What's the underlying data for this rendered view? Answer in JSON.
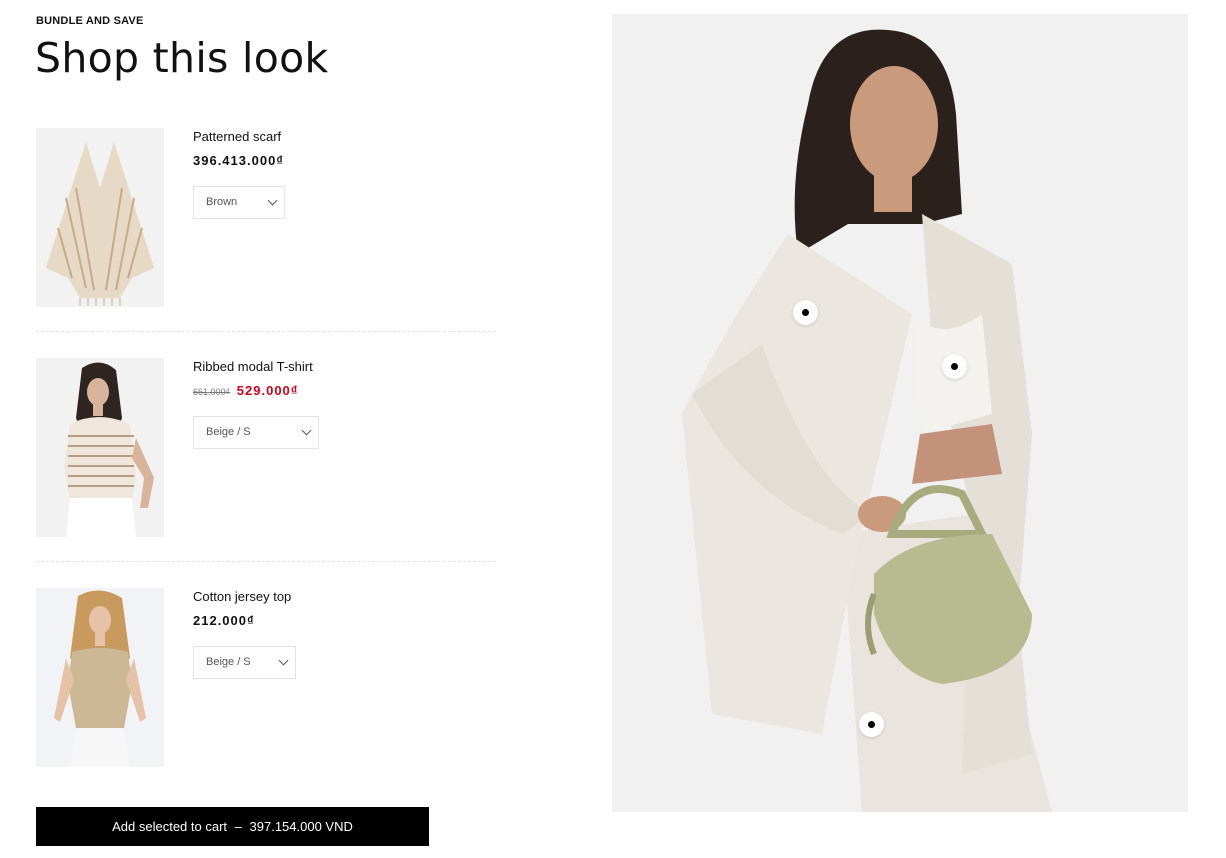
{
  "header": {
    "eyebrow": "BUNDLE AND SAVE",
    "title": "Shop this look"
  },
  "products": [
    {
      "name": "Patterned scarf",
      "price": "396.413.000₫",
      "variant": "Brown",
      "image": "patterned-scarf-image"
    },
    {
      "name": "Ribbed modal T-shirt",
      "old_price": "661.000₫",
      "sale_price": "529.000₫",
      "variant": "Beige / S",
      "image": "ribbed-tshirt-model-image"
    },
    {
      "name": "Cotton jersey top",
      "price": "212.000₫",
      "variant": "Beige / S",
      "image": "cotton-jersey-top-model-image"
    }
  ],
  "cart_button": {
    "label": "Add selected to cart",
    "separator": "–",
    "total": "397.154.000 VND"
  },
  "colors": {
    "sale_price": "#d0011b",
    "button_bg": "#000000",
    "thumb_bg": "#f2f2f2"
  }
}
